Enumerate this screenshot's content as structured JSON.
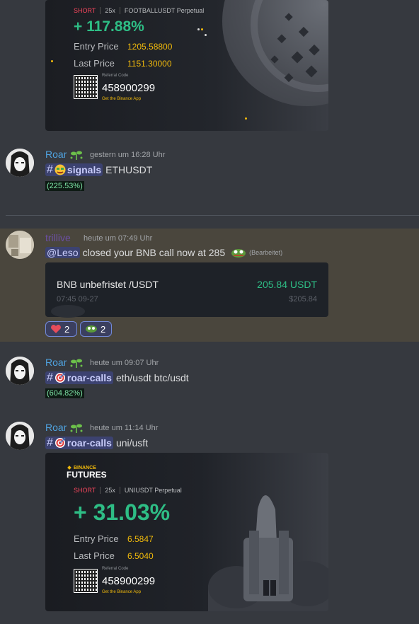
{
  "card_top": {
    "direction": "SHORT",
    "leverage": "25x",
    "pair": "FOOTBALLUSDT Perpetual",
    "pnl": "+ 117.88%",
    "entry_label": "Entry Price",
    "entry_value": "1205.58800",
    "last_label": "Last Price",
    "last_value": "1151.30000",
    "ref_label": "Referral Code",
    "ref_code": "458900299",
    "ref_app": "Get the Binance App"
  },
  "messages": [
    {
      "user": "Roar",
      "timestamp": "gestern um 16:28 Uhr",
      "channel": "signals",
      "text": "ETHUSDT",
      "pct": "(225.53%)"
    },
    {
      "user": "trillive",
      "timestamp": "heute um 07:49 Uhr",
      "mention": "@Leso",
      "text": "closed your BNB call now at 285",
      "edited": "(Bearbeitet)",
      "embed": {
        "title": "BNB unbefristet /USDT",
        "price": "205.84 USDT",
        "time": "07:45 09-27",
        "price_small": "$205.84"
      },
      "reactions": [
        {
          "icon": "heart-icon",
          "count": "2",
          "color": "#e74c5b"
        },
        {
          "icon": "pepe-icon",
          "count": "2",
          "color": "#5a9a3a"
        }
      ]
    },
    {
      "user": "Roar",
      "timestamp": "heute um 09:07 Uhr",
      "channel": "roar-calls",
      "text": "eth/usdt btc/usdt",
      "pct": "(604.82%)"
    },
    {
      "user": "Roar",
      "timestamp": "heute um 11:14 Uhr",
      "channel": "roar-calls",
      "text": "uni/usft"
    }
  ],
  "card_bottom": {
    "brand_top": "BINANCE",
    "brand_bottom": "FUTURES",
    "direction": "SHORT",
    "leverage": "25x",
    "pair": "UNIUSDT Perpetual",
    "pnl": "+ 31.03%",
    "entry_label": "Entry Price",
    "entry_value": "6.5847",
    "last_label": "Last Price",
    "last_value": "6.5040",
    "ref_label": "Referral Code",
    "ref_code": "458900299",
    "ref_app": "Get the Binance App"
  },
  "colors": {
    "background": "#36393f",
    "username_blue": "#4fa3e0",
    "username_purple": "#6b4fa3",
    "profit_green": "#2ebd85",
    "binance_yellow": "#f0b90b"
  }
}
